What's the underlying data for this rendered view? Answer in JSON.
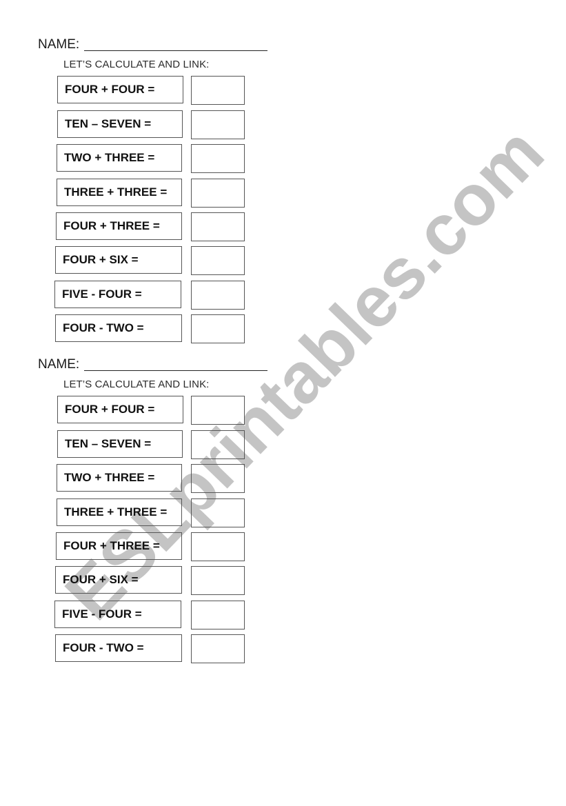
{
  "watermark": {
    "text": "ESLprintables.com",
    "color": "#c4c4c4"
  },
  "worksheets": [
    {
      "name_label": "NAME:",
      "subtitle": "LET’S CALCULATE AND LINK:",
      "exercises": [
        {
          "expression": "FOUR + FOUR =",
          "answer": ""
        },
        {
          "expression": "TEN – SEVEN =",
          "answer": ""
        },
        {
          "expression": "TWO + THREE =",
          "answer": ""
        },
        {
          "expression": "THREE + THREE =",
          "answer": ""
        },
        {
          "expression": "FOUR + THREE =",
          "answer": ""
        },
        {
          "expression": "FOUR + SIX =",
          "answer": ""
        },
        {
          "expression": "FIVE - FOUR =",
          "answer": ""
        },
        {
          "expression": "FOUR - TWO =",
          "answer": ""
        }
      ]
    },
    {
      "name_label": "NAME:",
      "subtitle": "LET’S CALCULATE AND LINK:",
      "exercises": [
        {
          "expression": "FOUR + FOUR =",
          "answer": ""
        },
        {
          "expression": "TEN – SEVEN =",
          "answer": ""
        },
        {
          "expression": "TWO + THREE =",
          "answer": ""
        },
        {
          "expression": "THREE + THREE =",
          "answer": ""
        },
        {
          "expression": "FOUR + THREE =",
          "answer": ""
        },
        {
          "expression": "FOUR + SIX =",
          "answer": ""
        },
        {
          "expression": "FIVE - FOUR =",
          "answer": ""
        },
        {
          "expression": "FOUR - TWO =",
          "answer": ""
        }
      ]
    }
  ]
}
